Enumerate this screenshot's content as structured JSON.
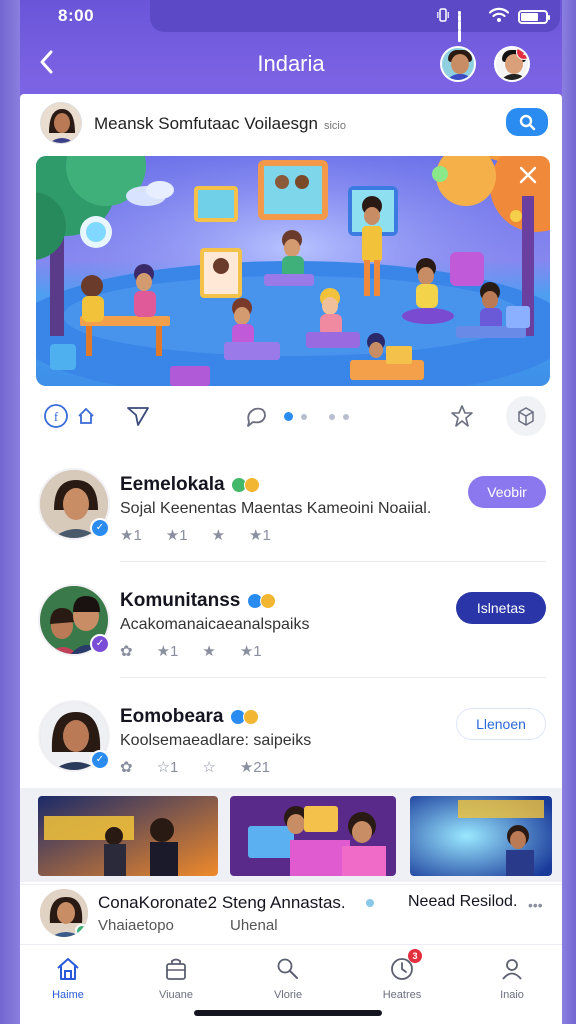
{
  "status": {
    "time": "8:00"
  },
  "appbar": {
    "title": "Indaria"
  },
  "post": {
    "header_text": "Meansk Somfutaac Voilaesgn",
    "header_meta": "sicio",
    "hero_image": "classroom-illustration"
  },
  "people": [
    {
      "name": "Eemelokala",
      "subtitle": "Sojal Keenentas Maentas Kameoini Noaiial.",
      "stat1": "★1",
      "stat2": "★1",
      "button": "Veobir",
      "verify_color": "#2a8cf0",
      "chip_colors": [
        "#44b86a",
        "#f2b632"
      ]
    },
    {
      "name": "Komunitanss",
      "subtitle": "Acakomanaicaeanalspaiks",
      "stat1": "★1",
      "stat2": "★1",
      "button": "Islnetas",
      "verify_color": "#7a4dd6",
      "chip_colors": [
        "#2a8cf0",
        "#f2b632"
      ]
    },
    {
      "name": "Eomobeara",
      "subtitle": "Koolsemaeadlare: saipeiks",
      "stat1": "☆1",
      "stat2": "★21",
      "button": "Llenoen",
      "verify_color": "#2a8cf0",
      "chip_colors": [
        "#2a8cf0",
        "#f2b632"
      ]
    }
  ],
  "mini_player": {
    "title": "ConaKoronate2 Steng Annastas.",
    "subtitle": "Vhaiaetopo",
    "subtitle2": "Uhenal",
    "right_text": "Neead Resilod."
  },
  "tabs": [
    {
      "label": "Haime",
      "icon": "home-icon",
      "active": true
    },
    {
      "label": "Viuane",
      "icon": "bag-icon",
      "active": false
    },
    {
      "label": "Vlorie",
      "icon": "search-icon",
      "active": false
    },
    {
      "label": "Heatres",
      "icon": "clock-icon",
      "active": false,
      "badge": "3"
    },
    {
      "label": "Inaio",
      "icon": "profile-icon",
      "active": false
    }
  ],
  "colors": {
    "accent": "#2a8cf0",
    "brand_purple": "#6b55d9",
    "dark_button": "#2a36a8"
  }
}
